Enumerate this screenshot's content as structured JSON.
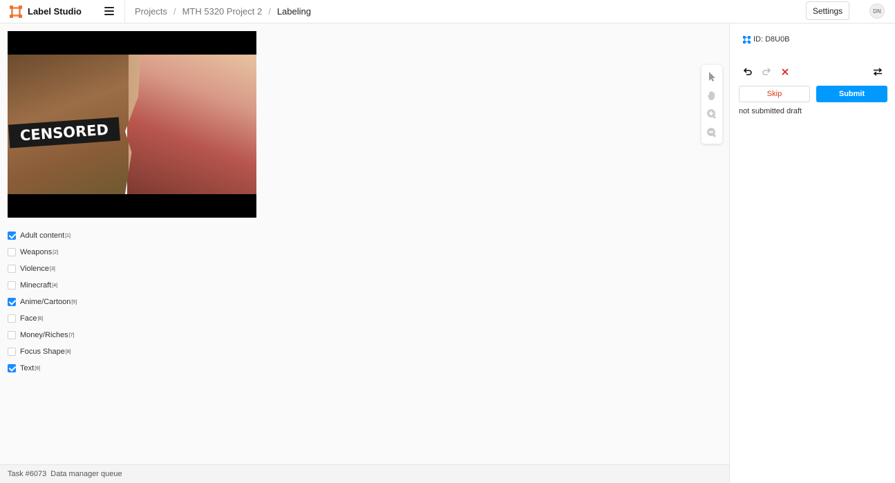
{
  "header": {
    "app_name": "Label Studio",
    "breadcrumbs": [
      "Projects",
      "MTH 5320 Project 2",
      "Labeling"
    ],
    "settings_label": "Settings",
    "avatar_initials": "DN"
  },
  "image": {
    "overlay_text": "CENSORED"
  },
  "tools": [
    "select-pointer-icon",
    "pan-hand-icon",
    "zoom-in-icon",
    "zoom-out-icon"
  ],
  "choices": [
    {
      "label": "Adult content",
      "hotkey": "[1]",
      "checked": true
    },
    {
      "label": "Weapons",
      "hotkey": "[2]",
      "checked": false
    },
    {
      "label": "Violence",
      "hotkey": "[3]",
      "checked": false
    },
    {
      "label": "Minecraft",
      "hotkey": "[4]",
      "checked": false
    },
    {
      "label": "Anime/Cartoon",
      "hotkey": "[5]",
      "checked": true
    },
    {
      "label": "Face",
      "hotkey": "[6]",
      "checked": false
    },
    {
      "label": "Money/Riches",
      "hotkey": "[7]",
      "checked": false
    },
    {
      "label": "Focus Shape",
      "hotkey": "[8]",
      "checked": false
    },
    {
      "label": "Text",
      "hotkey": "[9]",
      "checked": true
    }
  ],
  "footer": {
    "task": "Task #6073",
    "queue": "Data manager queue"
  },
  "side": {
    "annotation_id": "ID: D8U0B",
    "skip_label": "Skip",
    "submit_label": "Submit",
    "status": "not submitted draft"
  },
  "colors": {
    "accent": "#0099ff",
    "checkbox": "#1a8cff",
    "skip_text": "#d4380d",
    "logo": "#f0935e"
  }
}
